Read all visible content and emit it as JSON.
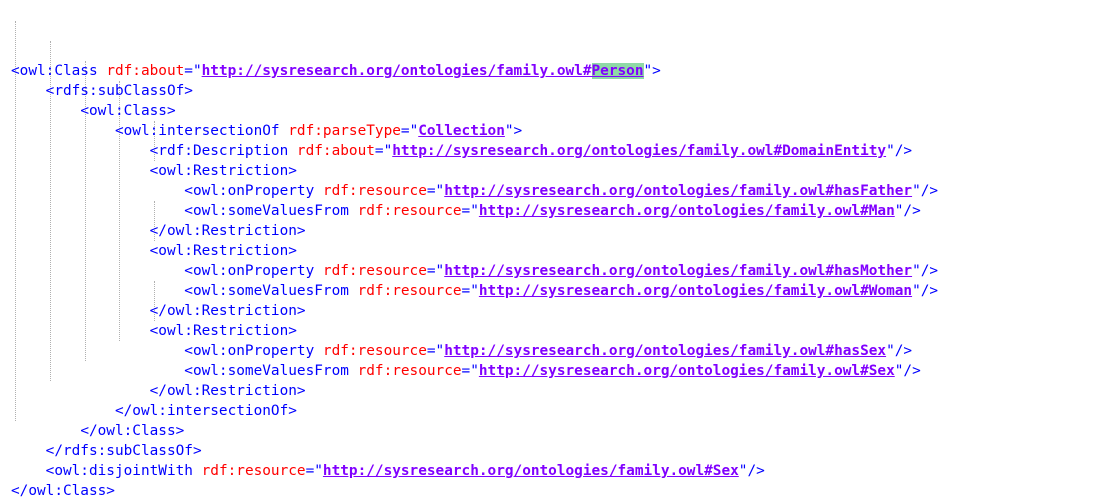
{
  "editor": {
    "lines": [
      {
        "indent": 0,
        "open": "<owl:Class",
        "attr": "rdf:about",
        "eq": "=\"",
        "value_pre": "http://sysresearch.org/ontologies/family.owl#",
        "value_hl": "Person",
        "close": "\">"
      },
      {
        "indent": 1,
        "open": "<rdfs:subClassOf>",
        "attr": "",
        "eq": "",
        "value_pre": "",
        "value_hl": "",
        "close": ""
      },
      {
        "indent": 2,
        "open": "<owl:Class>",
        "attr": "",
        "eq": "",
        "value_pre": "",
        "value_hl": "",
        "close": ""
      },
      {
        "indent": 3,
        "open": "<owl:intersectionOf",
        "attr": "rdf:parseType",
        "eq": "=\"",
        "value_pre": "Collection",
        "value_hl": "",
        "close": "\">"
      },
      {
        "indent": 4,
        "open": "<rdf:Description",
        "attr": "rdf:about",
        "eq": "=\"",
        "value_pre": "http://sysresearch.org/ontologies/family.owl#DomainEntity",
        "value_hl": "",
        "close": "\"/>"
      },
      {
        "indent": 4,
        "open": "<owl:Restriction>",
        "attr": "",
        "eq": "",
        "value_pre": "",
        "value_hl": "",
        "close": ""
      },
      {
        "indent": 5,
        "open": "<owl:onProperty",
        "attr": "rdf:resource",
        "eq": "=\"",
        "value_pre": "http://sysresearch.org/ontologies/family.owl#hasFather",
        "value_hl": "",
        "close": "\"/>"
      },
      {
        "indent": 5,
        "open": "<owl:someValuesFrom",
        "attr": "rdf:resource",
        "eq": "=\"",
        "value_pre": "http://sysresearch.org/ontologies/family.owl#Man",
        "value_hl": "",
        "close": "\"/>"
      },
      {
        "indent": 4,
        "open": "</owl:Restriction>",
        "attr": "",
        "eq": "",
        "value_pre": "",
        "value_hl": "",
        "close": ""
      },
      {
        "indent": 4,
        "open": "<owl:Restriction>",
        "attr": "",
        "eq": "",
        "value_pre": "",
        "value_hl": "",
        "close": ""
      },
      {
        "indent": 5,
        "open": "<owl:onProperty",
        "attr": "rdf:resource",
        "eq": "=\"",
        "value_pre": "http://sysresearch.org/ontologies/family.owl#hasMother",
        "value_hl": "",
        "close": "\"/>"
      },
      {
        "indent": 5,
        "open": "<owl:someValuesFrom",
        "attr": "rdf:resource",
        "eq": "=\"",
        "value_pre": "http://sysresearch.org/ontologies/family.owl#Woman",
        "value_hl": "",
        "close": "\"/>"
      },
      {
        "indent": 4,
        "open": "</owl:Restriction>",
        "attr": "",
        "eq": "",
        "value_pre": "",
        "value_hl": "",
        "close": ""
      },
      {
        "indent": 4,
        "open": "<owl:Restriction>",
        "attr": "",
        "eq": "",
        "value_pre": "",
        "value_hl": "",
        "close": ""
      },
      {
        "indent": 5,
        "open": "<owl:onProperty",
        "attr": "rdf:resource",
        "eq": "=\"",
        "value_pre": "http://sysresearch.org/ontologies/family.owl#hasSex",
        "value_hl": "",
        "close": "\"/>"
      },
      {
        "indent": 5,
        "open": "<owl:someValuesFrom",
        "attr": "rdf:resource",
        "eq": "=\"",
        "value_pre": "http://sysresearch.org/ontologies/family.owl#Sex",
        "value_hl": "",
        "close": "\"/>"
      },
      {
        "indent": 4,
        "open": "</owl:Restriction>",
        "attr": "",
        "eq": "",
        "value_pre": "",
        "value_hl": "",
        "close": ""
      },
      {
        "indent": 3,
        "open": "</owl:intersectionOf>",
        "attr": "",
        "eq": "",
        "value_pre": "",
        "value_hl": "",
        "close": ""
      },
      {
        "indent": 2,
        "open": "</owl:Class>",
        "attr": "",
        "eq": "",
        "value_pre": "",
        "value_hl": "",
        "close": ""
      },
      {
        "indent": 1,
        "open": "</rdfs:subClassOf>",
        "attr": "",
        "eq": "",
        "value_pre": "",
        "value_hl": "",
        "close": ""
      },
      {
        "indent": 1,
        "open": "<owl:disjointWith",
        "attr": "rdf:resource",
        "eq": "=\"",
        "value_pre": "http://sysresearch.org/ontologies/family.owl#Sex",
        "value_hl": "",
        "close": "\"/>"
      },
      {
        "indent": 0,
        "open": "</owl:Class>",
        "attr": "",
        "eq": "",
        "value_pre": "",
        "value_hl": "",
        "close": ""
      }
    ]
  },
  "colors": {
    "tag": "#0000ff",
    "attribute": "#ff0000",
    "value": "#8000ff",
    "highlight": "#8fd9a6"
  }
}
